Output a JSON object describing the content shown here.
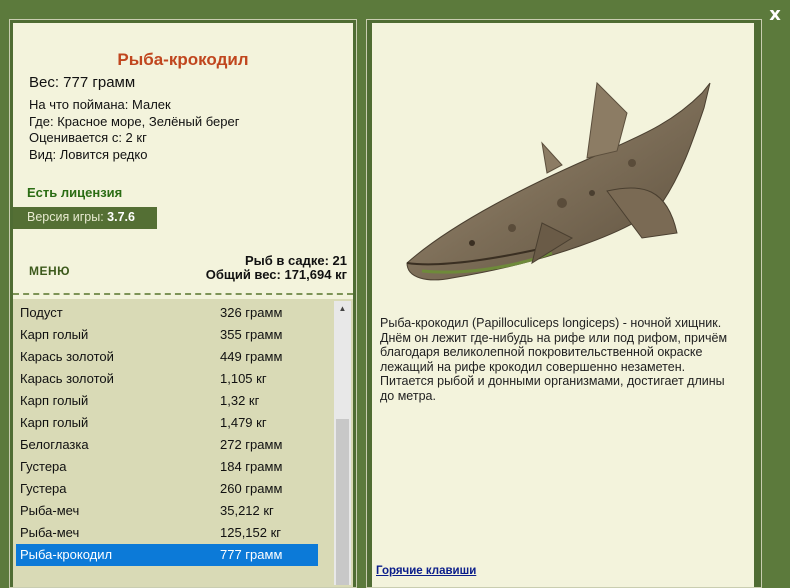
{
  "window": {
    "close_label": "x"
  },
  "catch": {
    "name": "Рыба-крокодил",
    "weight": "Вес: 777 грамм",
    "caught_on": "На что поймана: Малек",
    "location": "Где: Красное море, Зелёный берег",
    "valued_from": "Оценивается с: 2 кг",
    "rarity": "Вид: Ловится редко"
  },
  "license": "Есть лицензия",
  "version": {
    "label": "Версия игры:",
    "value": "3.7.6"
  },
  "menu_label": "МЕНЮ",
  "stats": {
    "in_keepnet": "Рыб в садке: 21",
    "total_weight": "Общий вес: 171,694 кг"
  },
  "fish_list": [
    {
      "name": "Подуст",
      "weight": "326 грамм"
    },
    {
      "name": "Карп голый",
      "weight": "355 грамм"
    },
    {
      "name": "Карась золотой",
      "weight": "449 грамм"
    },
    {
      "name": "Карась золотой",
      "weight": "1,105 кг"
    },
    {
      "name": "Карп голый",
      "weight": "1,32 кг"
    },
    {
      "name": "Карп голый",
      "weight": "1,479 кг"
    },
    {
      "name": "Белоглазка",
      "weight": "272 грамм"
    },
    {
      "name": "Густера",
      "weight": "184 грамм"
    },
    {
      "name": "Густера",
      "weight": "260 грамм"
    },
    {
      "name": "Рыба-меч",
      "weight": "35,212 кг"
    },
    {
      "name": "Рыба-меч",
      "weight": "125,152 кг"
    },
    {
      "name": "Рыба-крокодил",
      "weight": "777 грамм"
    }
  ],
  "selected_index": 11,
  "description": "Рыба-крокодил (Papilloculiceps longiceps) - ночной хищник. Днём он лежит где-нибудь на рифе или под рифом, причём благодаря великолепной покровительственной окраске лежащий на рифе крокодил совершенно незаметен. Питается рыбой и донными организмами, достигает длины до метра.",
  "hotkeys_link": "Горячие клавиши",
  "colors": {
    "background": "#5c7a3c",
    "panel": "#f3f3dc",
    "title": "#c0461e",
    "license": "#2b6d14",
    "selection": "#0c7ad8",
    "link": "#0a1d8a"
  },
  "icons": {
    "close": "close-icon",
    "scroll_up": "arrow-up-icon"
  }
}
